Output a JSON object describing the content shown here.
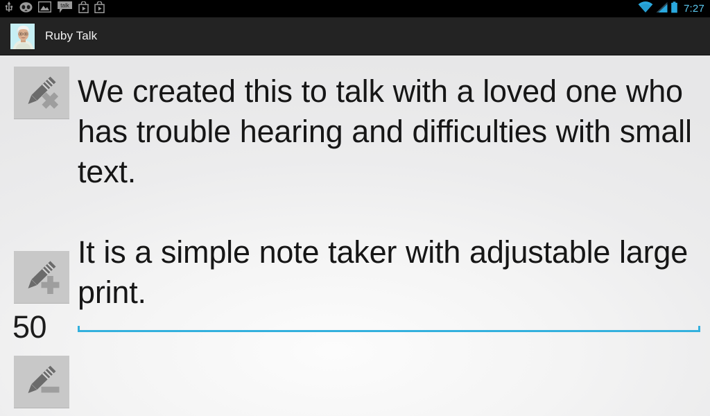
{
  "status_bar": {
    "clock": "7:27",
    "left_icons": [
      {
        "name": "usb-icon",
        "label": "USB connected"
      },
      {
        "name": "cyanogenmod-icon",
        "label": "CyanogenMod"
      },
      {
        "name": "screenshot-icon",
        "label": "Screenshot captured"
      },
      {
        "name": "talk-icon",
        "label": "talk"
      },
      {
        "name": "play-store-icon-1",
        "label": "Play Store"
      },
      {
        "name": "play-store-icon-2",
        "label": "Play Store"
      }
    ],
    "right_icons": [
      {
        "name": "wifi-icon",
        "label": "Wi-Fi"
      },
      {
        "name": "signal-icon",
        "label": "Cellular signal"
      },
      {
        "name": "battery-icon",
        "label": "Battery"
      }
    ],
    "accent_color": "#5bc8f0",
    "background_color": "#000000"
  },
  "action_bar": {
    "title": "Ruby Talk",
    "avatar_label": "Ruby",
    "background_color": "#232323",
    "title_color": "#f2f2f2"
  },
  "toolbar": {
    "clear_note_label": "Clear note",
    "increase_text_label": "Increase text size",
    "decrease_text_label": "Decrease text size",
    "font_size_value": "50",
    "button_background": "#c8c8c8",
    "glyph_color": "#6b6b6b"
  },
  "note": {
    "paragraph_1": "We created this to talk with a loved one who has trouble hearing and difficulties with small text.",
    "paragraph_2": "It is a simple note taker with adjustable large print.",
    "text_color": "#161616",
    "underline_color": "#33b0dd"
  }
}
